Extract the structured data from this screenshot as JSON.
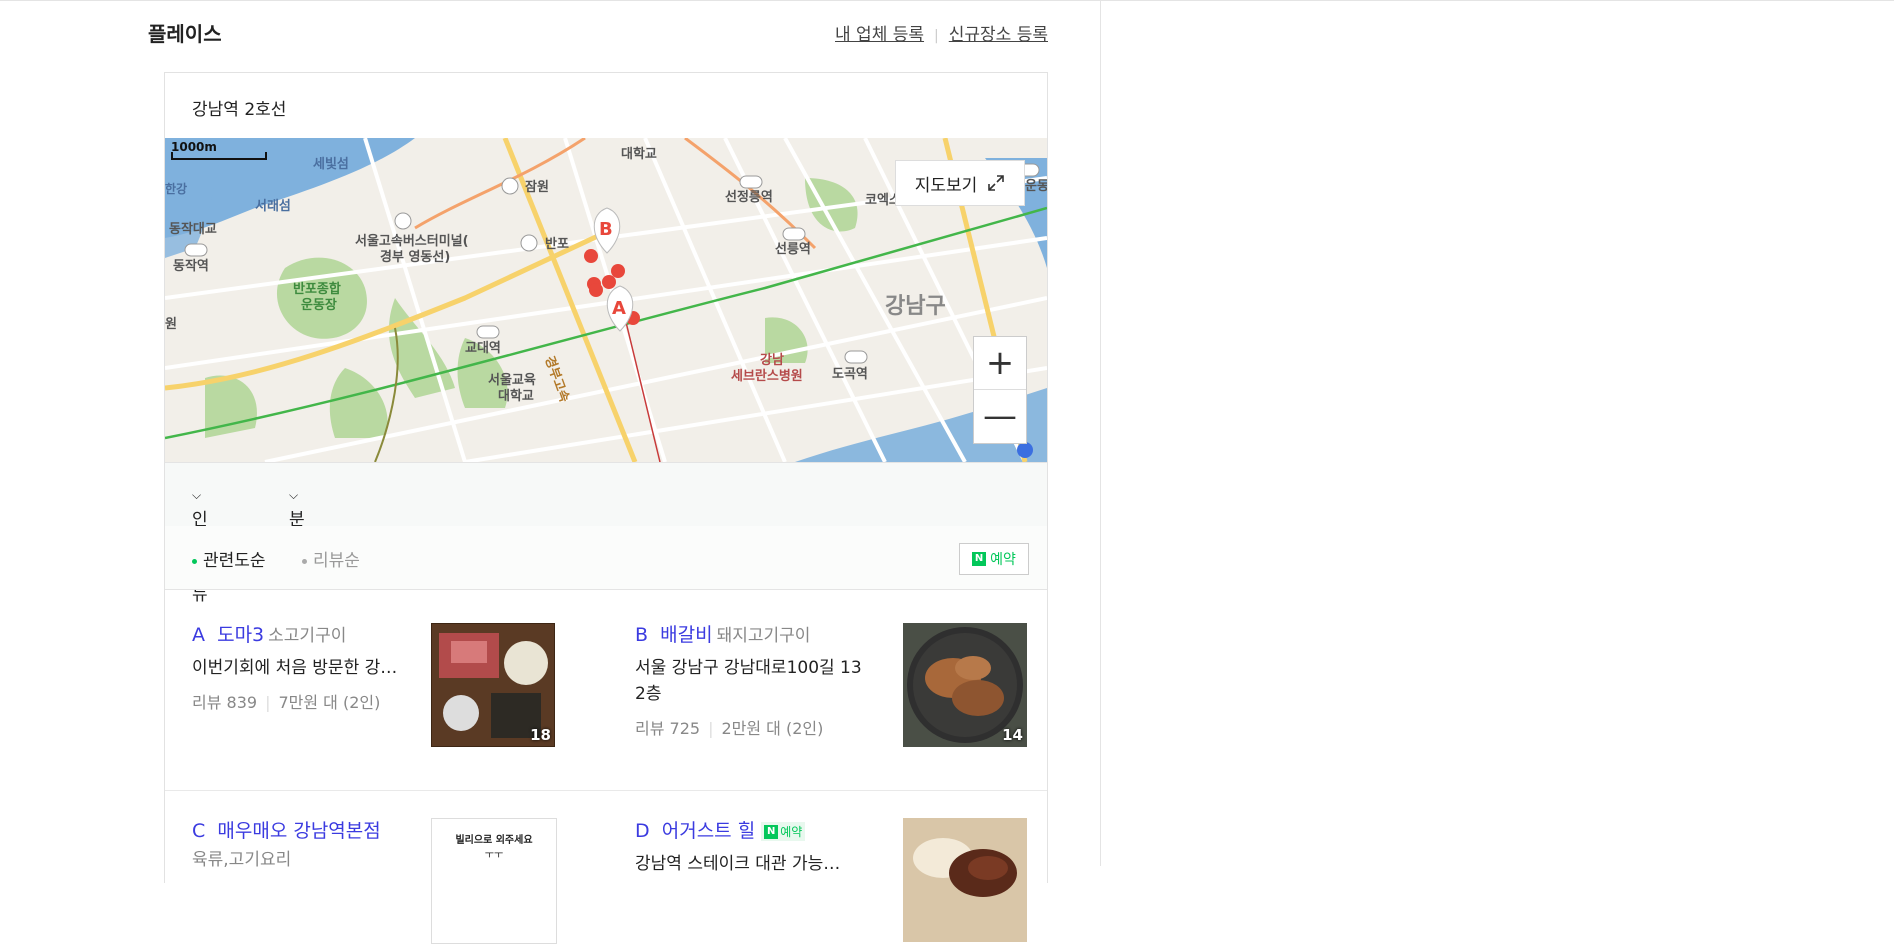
{
  "header": {
    "title": "플레이스",
    "link_register_business": "내 업체 등록",
    "link_register_place": "신규장소 등록"
  },
  "location": "강남역 2호선",
  "map": {
    "scale_label": "1000m",
    "view_map_button": "지도보기",
    "labels": [
      "세빛섬",
      "서래섬",
      "동작대교",
      "동작역",
      "한강",
      "잠원",
      "반포",
      "서울고속버스터미널(",
      "경부 영동선)",
      "반포종합",
      "운동장",
      "교대역",
      "서울교육",
      "대학교",
      "경부고속",
      "선정릉역",
      "선릉역",
      "코엑스",
      "강남구",
      "강남",
      "세브란스병원",
      "도곡역",
      "대학교",
      "운동",
      "강",
      "원"
    ],
    "markers": [
      "A",
      "B"
    ]
  },
  "filters": {
    "popular_menu": "인기메뉴",
    "atmosphere": "분위기"
  },
  "sort": {
    "relevance": "관련도순",
    "review": "리뷰순",
    "reservation": "예약",
    "n_icon": "N"
  },
  "places": [
    {
      "letter": "A",
      "name": "도마3",
      "category": "소고기구이",
      "desc": "이번기회에 처음 방문한 강…",
      "reviews": "리뷰 839",
      "price": "7만원 대 (2인)",
      "photo_count": "18"
    },
    {
      "letter": "B",
      "name": "배갈비",
      "category": "돼지고기구이",
      "desc": "서울 강남구 강남대로100길 13 2층",
      "reviews": "리뷰 725",
      "price": "2만원 대 (2인)",
      "photo_count": "14"
    },
    {
      "letter": "C",
      "name": "매우매오 강남역본점",
      "category": "육류,고기요리",
      "photo_text": "빌리으로 외주세요"
    },
    {
      "letter": "D",
      "name": "어거스트 힐",
      "reservation": "예약",
      "desc": "강남역 스테이크 대관 가능…"
    }
  ],
  "colors": {
    "link_blue": "#3b3be0",
    "naver_green": "#03c75a",
    "marker_red": "#e8473b"
  }
}
